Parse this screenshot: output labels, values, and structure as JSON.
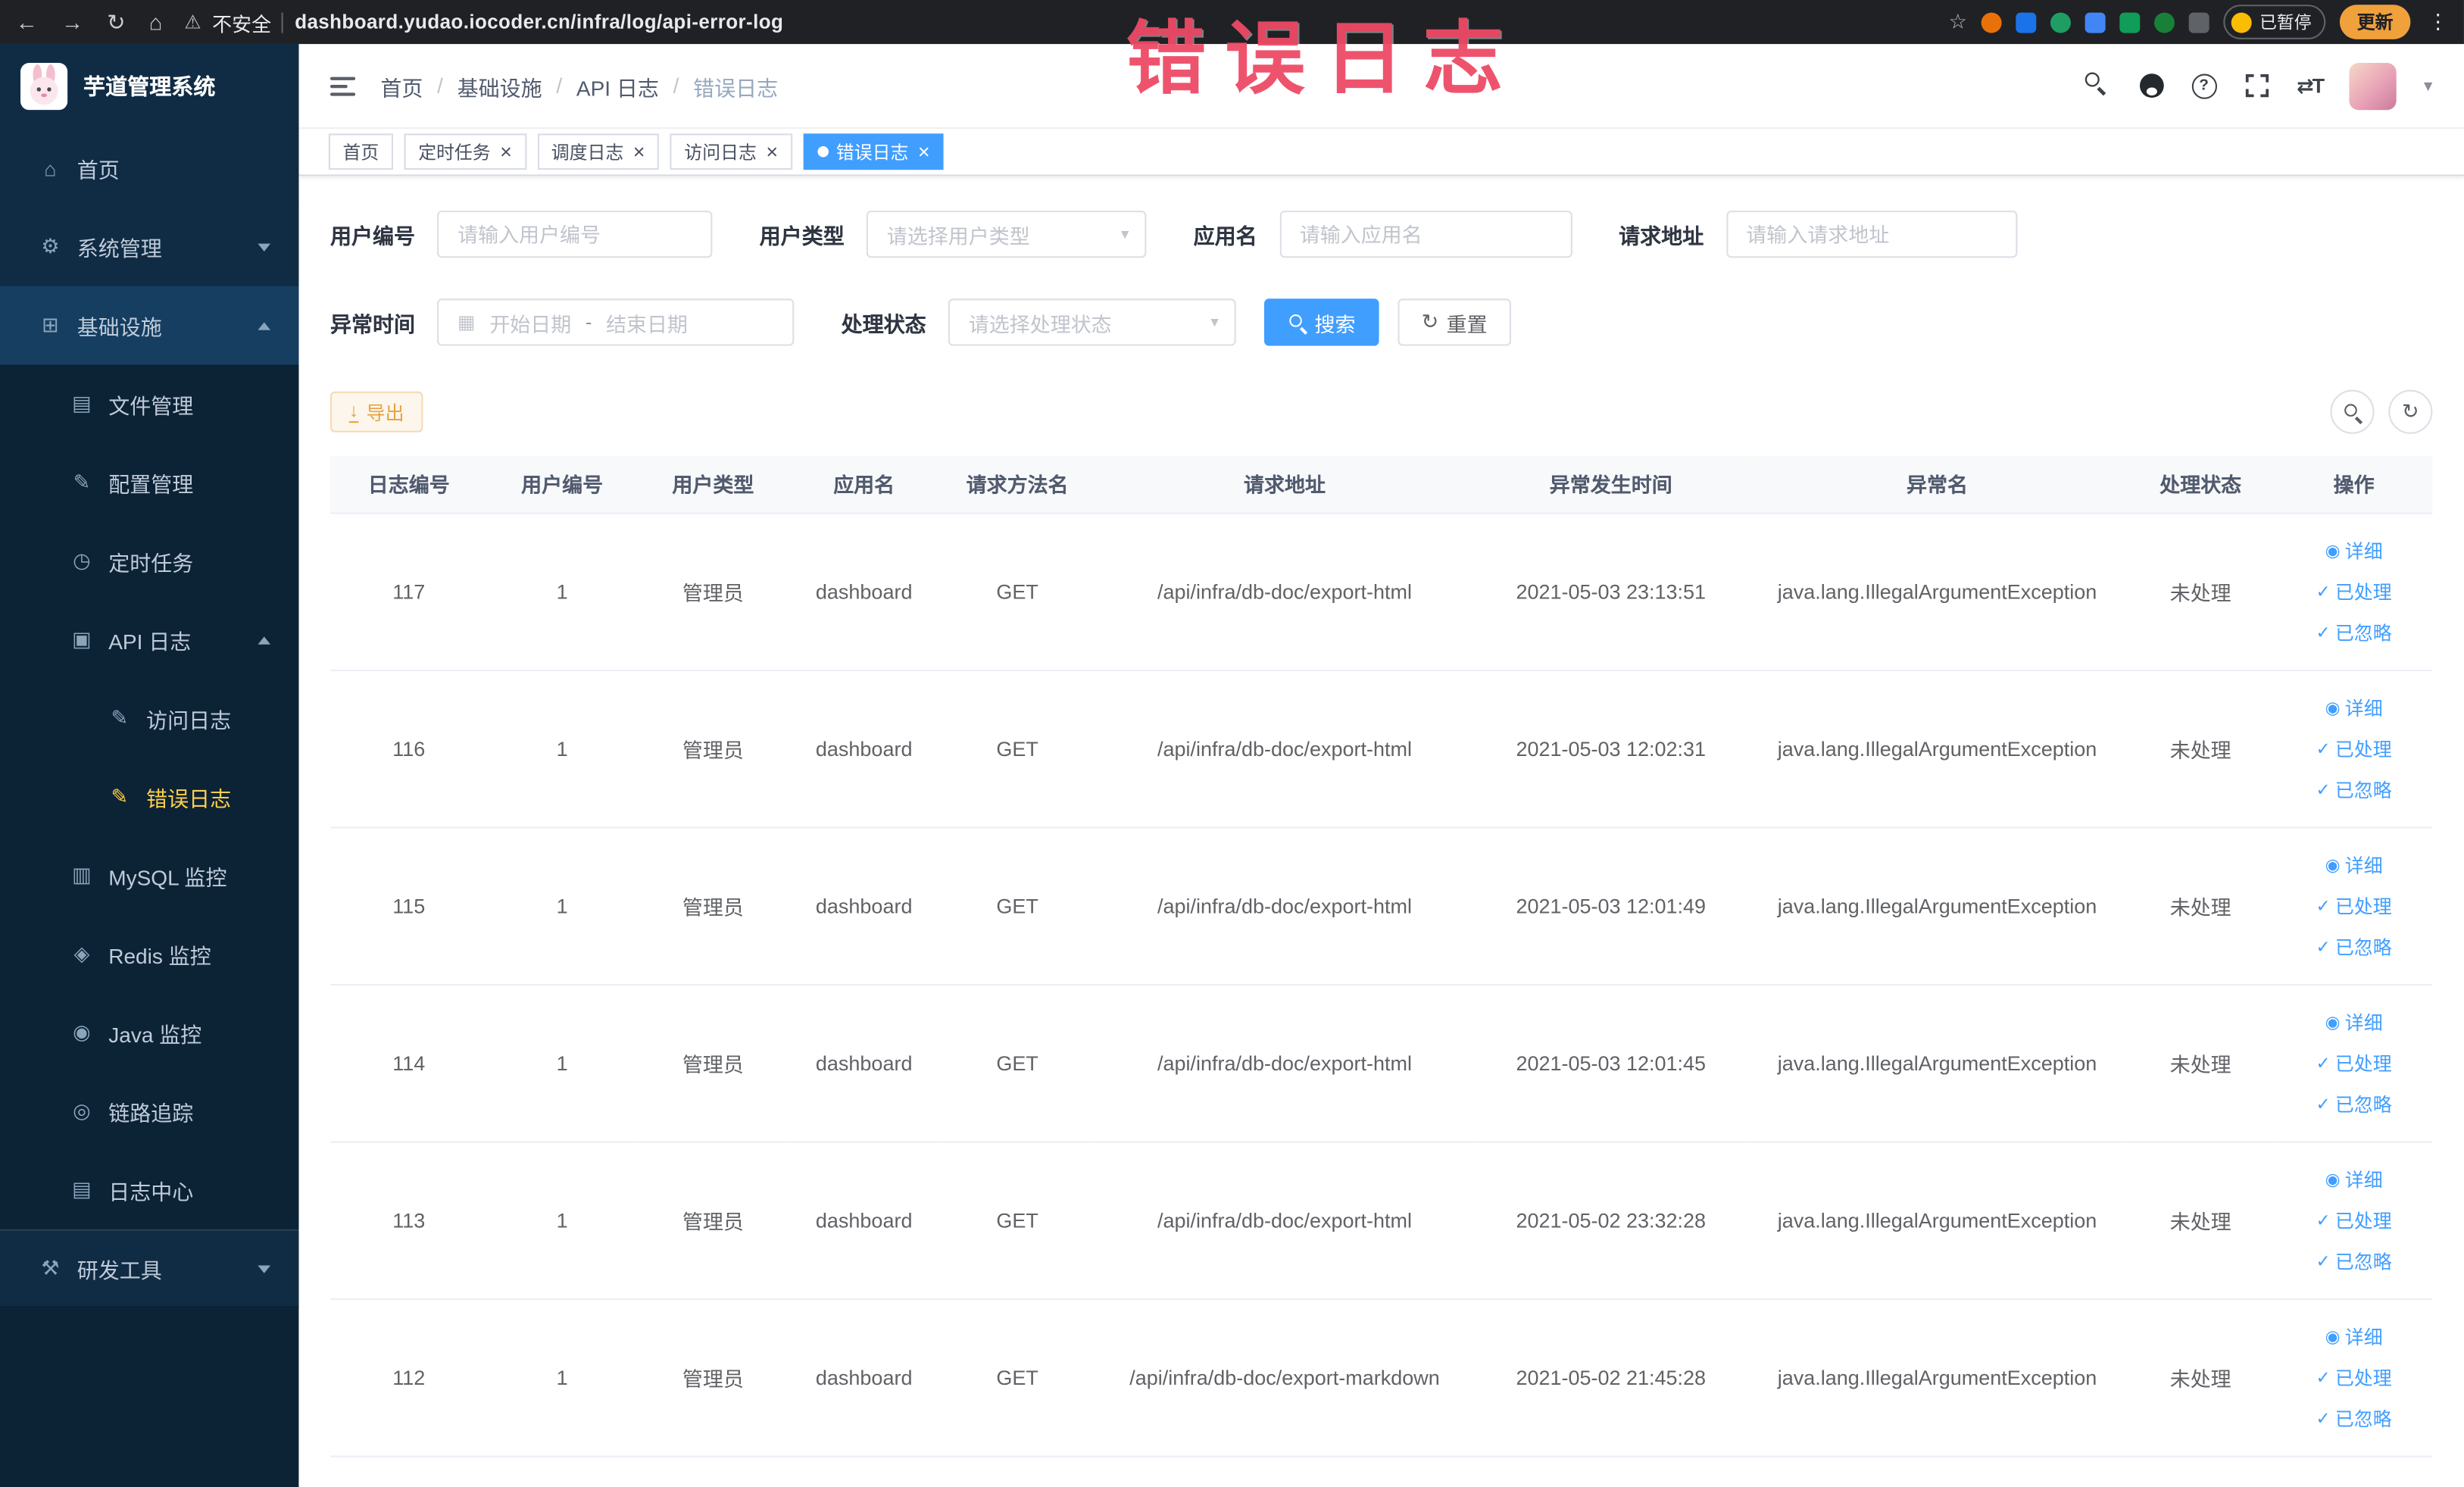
{
  "colors": {
    "primary": "#409EFF",
    "warning": "#E6A23C",
    "menu_active_text": "#FFD04B",
    "annotation": "#EE4A66"
  },
  "browser": {
    "security_label": "不安全",
    "url": "dashboard.yudao.iocoder.cn/infra/log/api-error-log",
    "paused_badge": "已暂停",
    "update_button": "更新"
  },
  "annotation": {
    "text": "错误日志"
  },
  "sidebar": {
    "logo_title": "芋道管理系统",
    "menu": [
      {
        "label": "首页",
        "icon": "home-icon",
        "level": 1
      },
      {
        "label": "系统管理",
        "icon": "gear-icon",
        "level": 1,
        "arrow": "down"
      },
      {
        "label": "基础设施",
        "icon": "infra-icon",
        "level": 1,
        "arrow": "up",
        "highlight": true
      },
      {
        "label": "文件管理",
        "icon": "file-icon",
        "level": 2
      },
      {
        "label": "配置管理",
        "icon": "config-icon",
        "level": 2
      },
      {
        "label": "定时任务",
        "icon": "timer-icon",
        "level": 2
      },
      {
        "label": "API 日志",
        "icon": "api-log-icon",
        "level": 2,
        "arrow": "up"
      },
      {
        "label": "访问日志",
        "icon": "access-log-icon",
        "level": 3
      },
      {
        "label": "错误日志",
        "icon": "error-log-icon",
        "level": 3,
        "active": true
      },
      {
        "label": "MySQL 监控",
        "icon": "mysql-icon",
        "level": 2
      },
      {
        "label": "Redis 监控",
        "icon": "redis-icon",
        "level": 2
      },
      {
        "label": "Java 监控",
        "icon": "java-icon",
        "level": 2
      },
      {
        "label": "链路追踪",
        "icon": "trace-icon",
        "level": 2
      },
      {
        "label": "日志中心",
        "icon": "log-center-icon",
        "level": 2
      },
      {
        "label": "研发工具",
        "icon": "tools-icon",
        "level": 1,
        "arrow": "down",
        "section": true
      }
    ]
  },
  "navbar": {
    "breadcrumb": [
      "首页",
      "基础设施",
      "API 日志",
      "错误日志"
    ]
  },
  "tags": [
    {
      "label": "首页",
      "closable": false,
      "active": false
    },
    {
      "label": "定时任务",
      "closable": true,
      "active": false
    },
    {
      "label": "调度日志",
      "closable": true,
      "active": false
    },
    {
      "label": "访问日志",
      "closable": true,
      "active": false
    },
    {
      "label": "错误日志",
      "closable": true,
      "active": true
    }
  ],
  "filters": {
    "user_id_label": "用户编号",
    "user_id_placeholder": "请输入用户编号",
    "user_type_label": "用户类型",
    "user_type_placeholder": "请选择用户类型",
    "app_name_label": "应用名",
    "app_name_placeholder": "请输入应用名",
    "request_url_label": "请求地址",
    "request_url_placeholder": "请输入请求地址",
    "exception_time_label": "异常时间",
    "start_date_placeholder": "开始日期",
    "end_date_placeholder": "结束日期",
    "range_separator": "-",
    "process_status_label": "处理状态",
    "process_status_placeholder": "请选择处理状态",
    "search_button": "搜索",
    "reset_button": "重置"
  },
  "toolbar": {
    "export_button": "导出"
  },
  "table": {
    "headers": [
      "日志编号",
      "用户编号",
      "用户类型",
      "应用名",
      "请求方法名",
      "请求地址",
      "异常发生时间",
      "异常名",
      "处理状态",
      "操作"
    ],
    "actions": [
      "详细",
      "已处理",
      "已忽略"
    ],
    "rows": [
      {
        "id": "117",
        "user_id": "1",
        "user_type": "管理员",
        "app": "dashboard",
        "method": "GET",
        "url": "/api/infra/db-doc/export-html",
        "time": "2021-05-03 23:13:51",
        "exception": "java.lang.IllegalArgumentException",
        "status": "未处理"
      },
      {
        "id": "116",
        "user_id": "1",
        "user_type": "管理员",
        "app": "dashboard",
        "method": "GET",
        "url": "/api/infra/db-doc/export-html",
        "time": "2021-05-03 12:02:31",
        "exception": "java.lang.IllegalArgumentException",
        "status": "未处理"
      },
      {
        "id": "115",
        "user_id": "1",
        "user_type": "管理员",
        "app": "dashboard",
        "method": "GET",
        "url": "/api/infra/db-doc/export-html",
        "time": "2021-05-03 12:01:49",
        "exception": "java.lang.IllegalArgumentException",
        "status": "未处理"
      },
      {
        "id": "114",
        "user_id": "1",
        "user_type": "管理员",
        "app": "dashboard",
        "method": "GET",
        "url": "/api/infra/db-doc/export-html",
        "time": "2021-05-03 12:01:45",
        "exception": "java.lang.IllegalArgumentException",
        "status": "未处理"
      },
      {
        "id": "113",
        "user_id": "1",
        "user_type": "管理员",
        "app": "dashboard",
        "method": "GET",
        "url": "/api/infra/db-doc/export-html",
        "time": "2021-05-02 23:32:28",
        "exception": "java.lang.IllegalArgumentException",
        "status": "未处理"
      },
      {
        "id": "112",
        "user_id": "1",
        "user_type": "管理员",
        "app": "dashboard",
        "method": "GET",
        "url": "/api/infra/db-doc/export-markdown",
        "time": "2021-05-02 21:45:28",
        "exception": "java.lang.IllegalArgumentException",
        "status": "未处理"
      }
    ]
  }
}
